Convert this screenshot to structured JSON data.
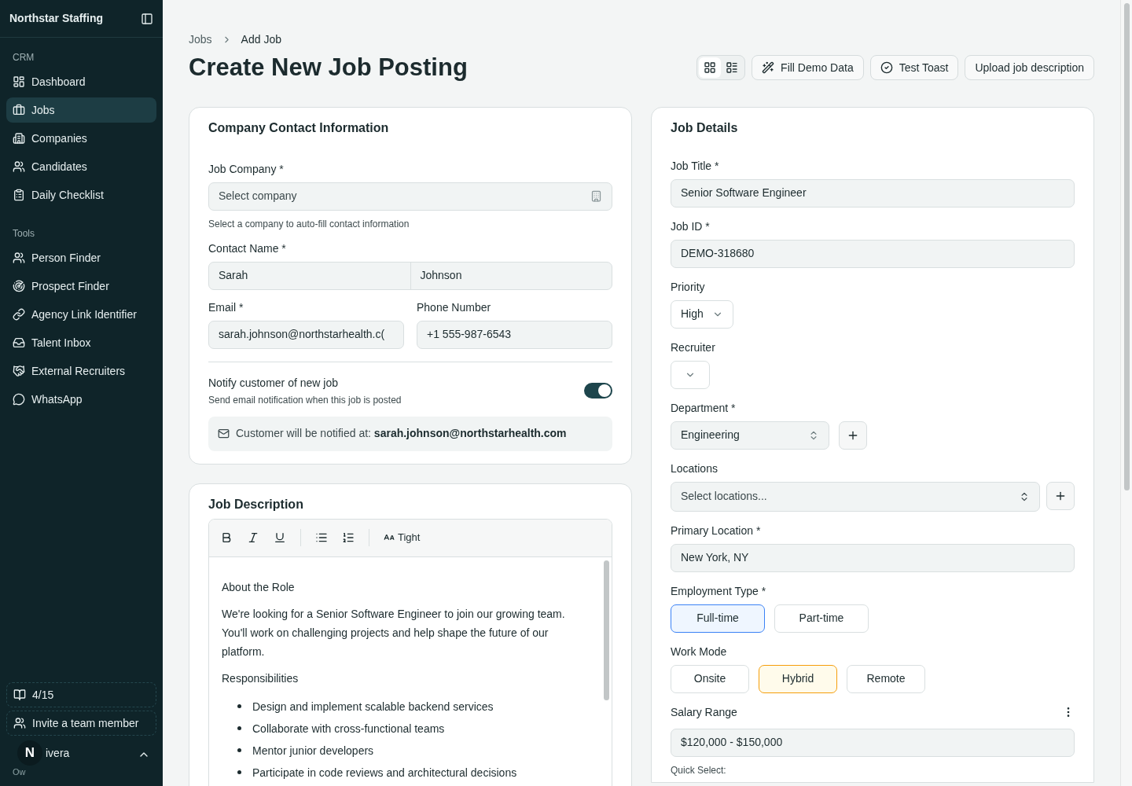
{
  "sidebar": {
    "brand": "Northstar Staffing",
    "sections": [
      {
        "title": "CRM",
        "items": [
          {
            "label": "Dashboard",
            "selected": false
          },
          {
            "label": "Jobs",
            "selected": true
          },
          {
            "label": "Companies",
            "selected": false
          },
          {
            "label": "Candidates",
            "selected": false
          },
          {
            "label": "Daily Checklist",
            "selected": false
          }
        ]
      },
      {
        "title": "Tools",
        "items": [
          {
            "label": "Person Finder",
            "selected": false
          },
          {
            "label": "Prospect Finder",
            "selected": false
          },
          {
            "label": "Agency Link Identifier",
            "selected": false
          },
          {
            "label": "Talent Inbox",
            "selected": false
          },
          {
            "label": "External Recruiters",
            "selected": false
          },
          {
            "label": "WhatsApp",
            "selected": false
          }
        ]
      }
    ],
    "footer_buttons": [
      "4/15",
      "Invite a team member"
    ],
    "user": {
      "avatar": "N",
      "name": "ivera",
      "role": "Ow"
    }
  },
  "breadcrumb": [
    "Jobs",
    "Add Job"
  ],
  "title": "Create New Job Posting",
  "view_toggle": [
    {
      "kind": "grid",
      "selected": true
    },
    {
      "kind": "list",
      "selected": false
    }
  ],
  "actions": [
    "Fill Demo Data",
    "Test Toast",
    "Upload job description"
  ],
  "contact_card": {
    "title": "Company Contact Information",
    "company": {
      "label": "Job Company *",
      "placeholder": "Select company",
      "hint": "Select a company to auto-fill contact information"
    },
    "contact_name": {
      "label": "Contact Name *",
      "first": "Sarah",
      "last": "Johnson"
    },
    "email": {
      "label": "Email *",
      "value": "sarah.johnson@northstarhealth.c("
    },
    "phone": {
      "label": "Phone Number",
      "value": "+1 555-987-6543"
    },
    "notify": {
      "label": "Notify customer of new job",
      "description": "Send email notification when this job is posted",
      "on": true,
      "message": "Customer will be notified at: **sarah.johnson@northstarhealth.com**"
    }
  },
  "description_card": {
    "title": "Job Description",
    "toolbar_label": "Tight",
    "blocks": [
      {
        "kind": "paragraph",
        "text": "About the Role"
      },
      {
        "kind": "paragraph",
        "text": "We're looking for a Senior Software Engineer to join our growing team. You'll work on challenging projects and help shape the future of our platform."
      },
      {
        "kind": "paragraph",
        "text": "Responsibilities"
      },
      {
        "kind": "bullets",
        "items": [
          "Design and implement scalable backend services",
          "Collaborate with cross-functional teams",
          "Mentor junior developers",
          "Participate in code reviews and architectural decisions"
        ]
      }
    ]
  },
  "job_card": {
    "title": "Job Details",
    "job_title": {
      "label": "Job Title *",
      "value": "Senior Software Engineer"
    },
    "job_id": {
      "label": "Job ID *",
      "value": "DEMO-318680"
    },
    "priority": {
      "label": "Priority",
      "value": "High"
    },
    "recruiter": {
      "label": "Recruiter"
    },
    "department": {
      "label": "Department *",
      "value": "Engineering"
    },
    "locations": {
      "label": "Locations",
      "placeholder": "Select locations..."
    },
    "primary_location": {
      "label": "Primary Location *",
      "value": "New York, NY"
    },
    "employment_type": {
      "label": "Employment Type *",
      "options": [
        {
          "label": "Full-time",
          "selected": true
        },
        {
          "label": "Part-time",
          "selected": false
        }
      ]
    },
    "work_mode": {
      "label": "Work Mode",
      "options": [
        {
          "label": "Onsite",
          "selected": false
        },
        {
          "label": "Hybrid",
          "selected": true
        },
        {
          "label": "Remote",
          "selected": false
        }
      ]
    },
    "salary": {
      "label": "Salary Range",
      "value": "$120,000 - $150,000",
      "quick_label": "Quick Select:"
    }
  }
}
